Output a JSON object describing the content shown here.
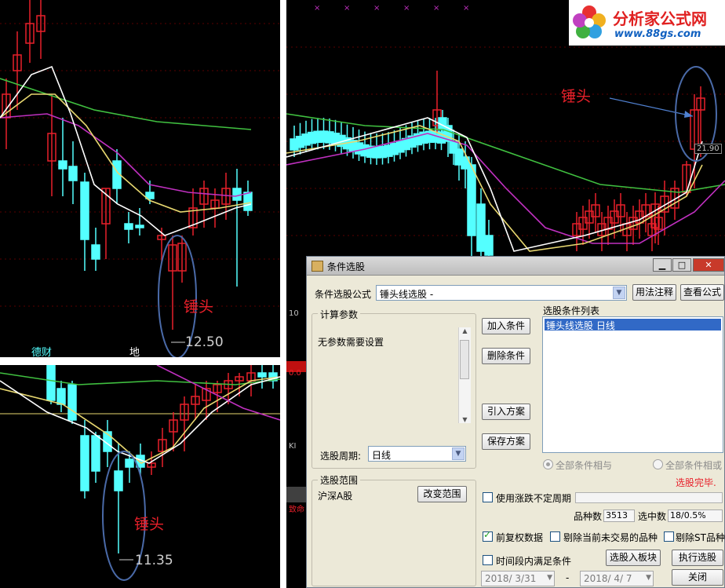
{
  "annotations": {
    "hammer_label": "锤头",
    "price_a": "12.50",
    "price_b": "11.35",
    "price_c": "21.90",
    "bottom_tag_a": "德财",
    "bottom_tag_b": "地"
  },
  "logo": {
    "name": "分析家公式网",
    "url": "www.88gs.com"
  },
  "dialog": {
    "title": "条件选股",
    "title_buttons": {
      "minimize": "▁",
      "maximize": "□",
      "close": "✕"
    },
    "formula_label": "条件选股公式",
    "formula_value": "锤头线选股    -",
    "usage_button": "用法注释",
    "view_formula_button": "查看公式",
    "params_group": "计算参数",
    "params_text": "无参数需要设置",
    "period_label": "选股周期:",
    "period_value": "日线",
    "range_group": "选股范围",
    "range_value": "沪深A股",
    "change_range_button": "改变范围",
    "add_condition_button": "加入条件",
    "delete_condition_button": "删除条件",
    "import_scheme_button": "引入方案",
    "save_scheme_button": "保存方案",
    "condition_list_label": "选股条件列表",
    "conditions": [
      "锤头线选股   日线"
    ],
    "all_and_label": "全部条件相与",
    "all_or_label": "全部条件相或",
    "status_text": "选股完毕.",
    "use_uncertain_period": "使用涨跌不定周期",
    "stock_count_label": "品种数",
    "stock_count_value": "3513",
    "selected_count_label": "选中数",
    "selected_count_value": "18/0.5%",
    "forward_adjust_label": "前复权数据",
    "exclude_untraded_label": "剔除当前未交易的品种",
    "exclude_st_label": "剔除ST品种",
    "time_range_label": "时间段内满足条件",
    "to_board_button": "选股入板块",
    "execute_button": "执行选股",
    "date_from": "2018/ 3/31",
    "date_sep": "-",
    "date_to": "2018/ 4/ 7",
    "close_button": "关闭"
  },
  "background_chart_labels": {
    "label_100": "10",
    "label_0": "0.0",
    "label_ki": "KI",
    "label_amount": "致命"
  },
  "colors": {
    "up_candle": "#e8202a",
    "down_candle": "#54ffff",
    "ma_white": "#ffffff",
    "ma_yellow": "#e8d870",
    "ma_purple": "#c030c0",
    "ma_green": "#40c040",
    "ellipse": "#4a6aa8",
    "status_red": "#e8202a",
    "selection": "#3169c6"
  }
}
